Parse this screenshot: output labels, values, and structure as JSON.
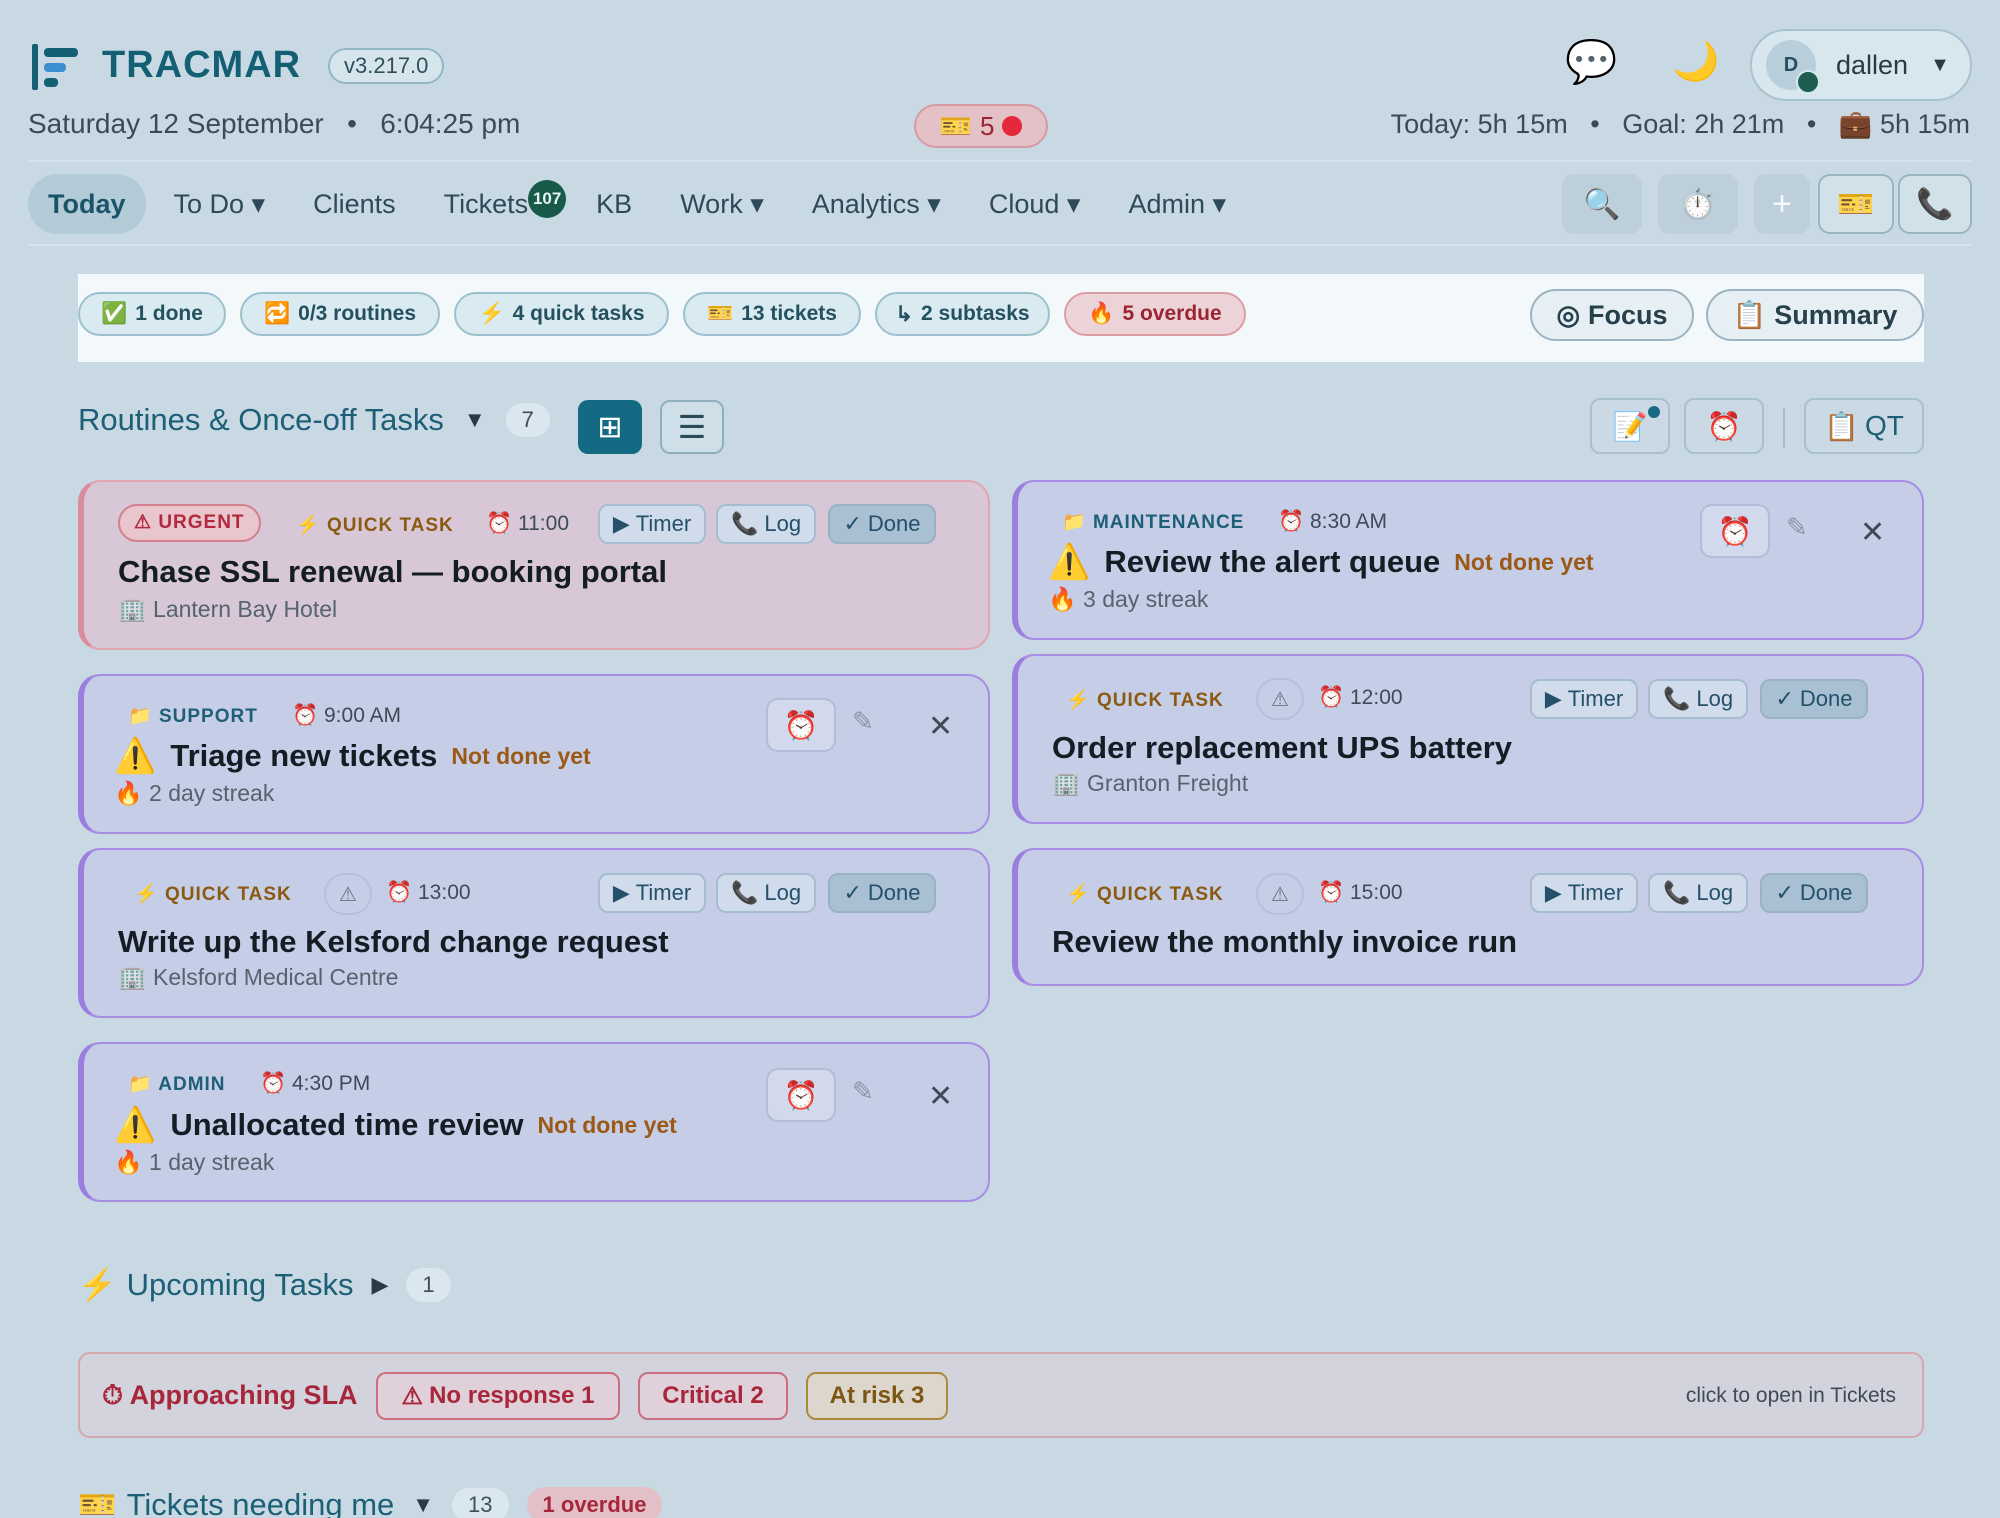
{
  "app": {
    "name": "TRACMAR",
    "version": "v3.217.0"
  },
  "header": {
    "date": "Saturday 12 September",
    "time": "6:04:25 pm",
    "ticket_count": "5",
    "user_initial": "D",
    "username": "dallen",
    "today": "Today: 5h 15m",
    "goal": "Goal: 2h 21m",
    "work": "5h 15m"
  },
  "nav": {
    "items": [
      "Today",
      "To Do ▾",
      "Clients",
      "Tickets",
      "KB",
      "Work ▾",
      "Analytics ▾",
      "Cloud ▾",
      "Admin ▾"
    ],
    "tickets_badge": "107"
  },
  "summary": {
    "done": "1 done",
    "routines": "0/3 routines",
    "quick": "4 quick tasks",
    "tickets": "13 tickets",
    "subtasks": "2 subtasks",
    "overdue": "5 overdue",
    "focus": "Focus",
    "summary": "Summary"
  },
  "routines": {
    "title": "Routines & Once-off Tasks",
    "count": "7",
    "qt_label": "QT"
  },
  "labels": {
    "quick_task": "QUICK TASK",
    "urgent": "URGENT",
    "timer": "Timer",
    "log": "Log",
    "done": "Done",
    "not_done": "Not done yet"
  },
  "cards": {
    "c1": {
      "time": "11:00",
      "title": "Chase SSL renewal — booking portal",
      "client": "Lantern Bay Hotel"
    },
    "c2": {
      "category": "MAINTENANCE",
      "time": "8:30 AM",
      "title": "Review the alert queue",
      "streak": "3 day streak"
    },
    "c3": {
      "category": "SUPPORT",
      "time": "9:00 AM",
      "title": "Triage new tickets",
      "streak": "2 day streak"
    },
    "c4": {
      "time": "12:00",
      "title": "Order replacement UPS battery",
      "client": "Granton Freight"
    },
    "c5": {
      "time": "13:00",
      "title": "Write up the Kelsford change request",
      "client": "Kelsford Medical Centre"
    },
    "c6": {
      "time": "15:00",
      "title": "Review the monthly invoice run"
    },
    "c7": {
      "category": "ADMIN",
      "time": "4:30 PM",
      "title": "Unallocated time review",
      "streak": "1 day streak"
    }
  },
  "upcoming": {
    "title": "Upcoming Tasks",
    "count": "1"
  },
  "sla": {
    "title": "Approaching SLA",
    "no_response": "No response 1",
    "critical": "Critical 2",
    "at_risk": "At risk 3",
    "hint": "click to open in Tickets"
  },
  "tickets_section": {
    "title": "Tickets needing me",
    "count": "13",
    "overdue": "1 overdue"
  },
  "colors": {
    "accent": "#136a82",
    "urgent": "#b2283c",
    "card_border": "#a88de4",
    "background": "#c9d9e4"
  }
}
